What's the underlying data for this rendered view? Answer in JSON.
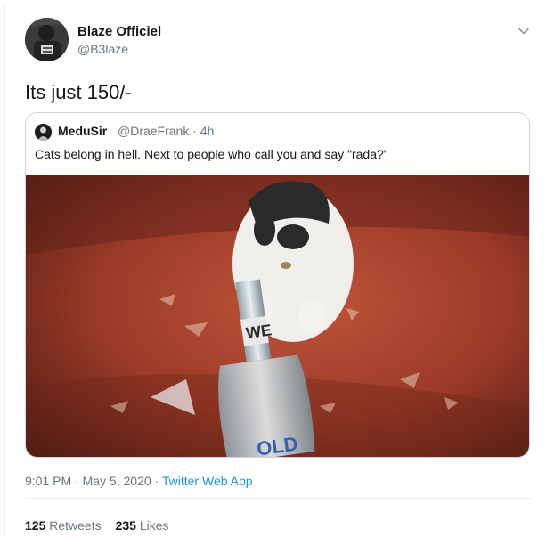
{
  "author": {
    "name": "Blaze Officiel",
    "handle": "@B3laze"
  },
  "tweet": {
    "text": "Its just 150/-"
  },
  "quoted": {
    "name": "MeduSir",
    "handle": "@DraeFrank",
    "separator": "·",
    "age": "4h",
    "text": "Cats belong in hell. Next to people who call you and say \"rada?\"",
    "media_icon": "photo-of-cat-with-broken-bottle"
  },
  "meta": {
    "time": "9:01 PM",
    "separator": "·",
    "date": "May 5, 2020",
    "app": "Twitter Web App"
  },
  "stats": {
    "retweets_count": "125",
    "retweets_label": "Retweets",
    "likes_count": "235",
    "likes_label": "Likes"
  },
  "icons": {
    "menu": "chevron-down-icon"
  },
  "colors": {
    "text": "#14171a",
    "secondary": "#657786",
    "link": "#1b95e0",
    "border": "#ccd6dd"
  }
}
